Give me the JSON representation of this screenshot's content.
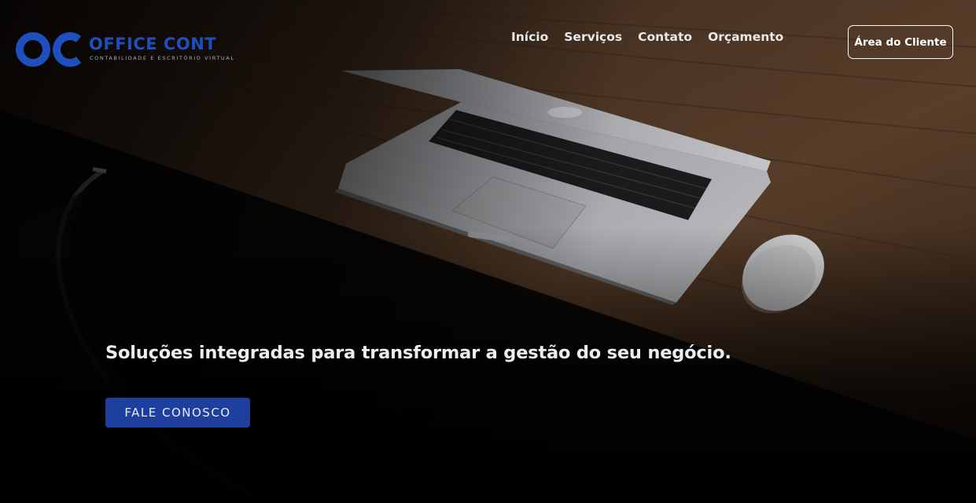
{
  "brand": {
    "name": "OFFICE CONT",
    "tagline": "CONTABILIDADE E ESCRITÓRIO VIRTUAL",
    "color": "#1f4fbf"
  },
  "nav": {
    "items": [
      {
        "label": "Início"
      },
      {
        "label": "Serviços"
      },
      {
        "label": "Contato"
      },
      {
        "label": "Orçamento"
      }
    ],
    "client_button": "Área do Cliente"
  },
  "hero": {
    "headline": "Soluções integradas para transformar a gestão do seu negócio.",
    "cta_label": "FALE CONOSCO",
    "cta_color": "#1e3f9e"
  }
}
